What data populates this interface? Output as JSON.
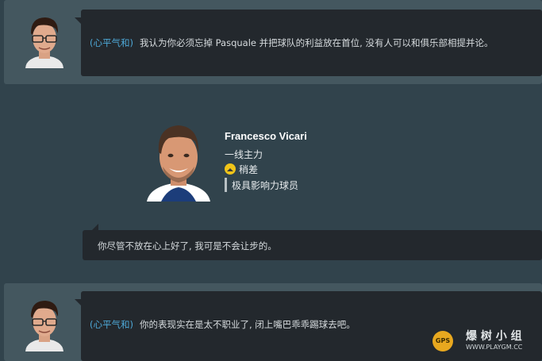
{
  "conversation": [
    {
      "speaker": "manager",
      "tone": "(心平气和)",
      "text": "我认为你必须忘掉 Pasquale 并把球队的利益放在首位, 没有人可以和俱乐部相提并论。"
    },
    {
      "speaker": "player",
      "text": "你尽管不放在心上好了, 我可是不会让步的。"
    },
    {
      "speaker": "manager",
      "tone": "(心平气和)",
      "text": "你的表现实在是太不职业了, 闭上嘴巴乖乖踢球去吧。"
    }
  ],
  "player": {
    "name": "Francesco Vicari",
    "role": "一线主力",
    "status": "稍差",
    "influence": "极具影响力球员"
  },
  "watermark": {
    "site_name": "爆 树 小 组",
    "url": "WWW.PLAYGM.CC"
  },
  "colors": {
    "tone": "#4ea9d8",
    "status_icon": "#f0c419"
  }
}
